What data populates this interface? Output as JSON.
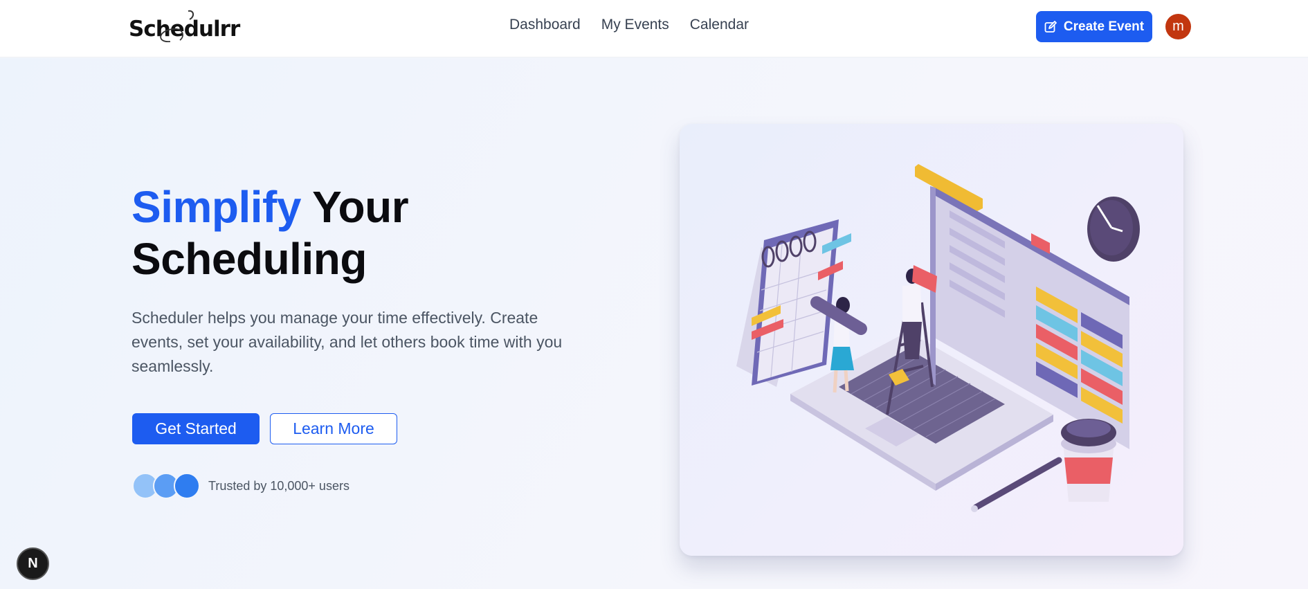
{
  "header": {
    "logo_text": "Schedulrr",
    "nav": [
      "Dashboard",
      "My Events",
      "Calendar"
    ],
    "create_label": "Create Event",
    "create_icon": "edit-icon",
    "avatar_initial": "m"
  },
  "hero": {
    "headline_accent": "Simplify",
    "headline_rest_1": "Your",
    "headline_rest_2": "Scheduling",
    "subtext": "Scheduler helps you manage your time effectively. Create events, set your availability, and let others book time with you seamlessly.",
    "primary_label": "Get Started",
    "secondary_label": "Learn More",
    "trusted_text": "Trusted by 10,000+ users",
    "trusted_avatar_colors": [
      "#93c2f8",
      "#5b9df4",
      "#2f7df0"
    ]
  },
  "colors": {
    "accent": "#1d5cf0",
    "avatar": "#c2360f"
  },
  "badge": {
    "label": "N",
    "icon": "nextjs-icon"
  }
}
